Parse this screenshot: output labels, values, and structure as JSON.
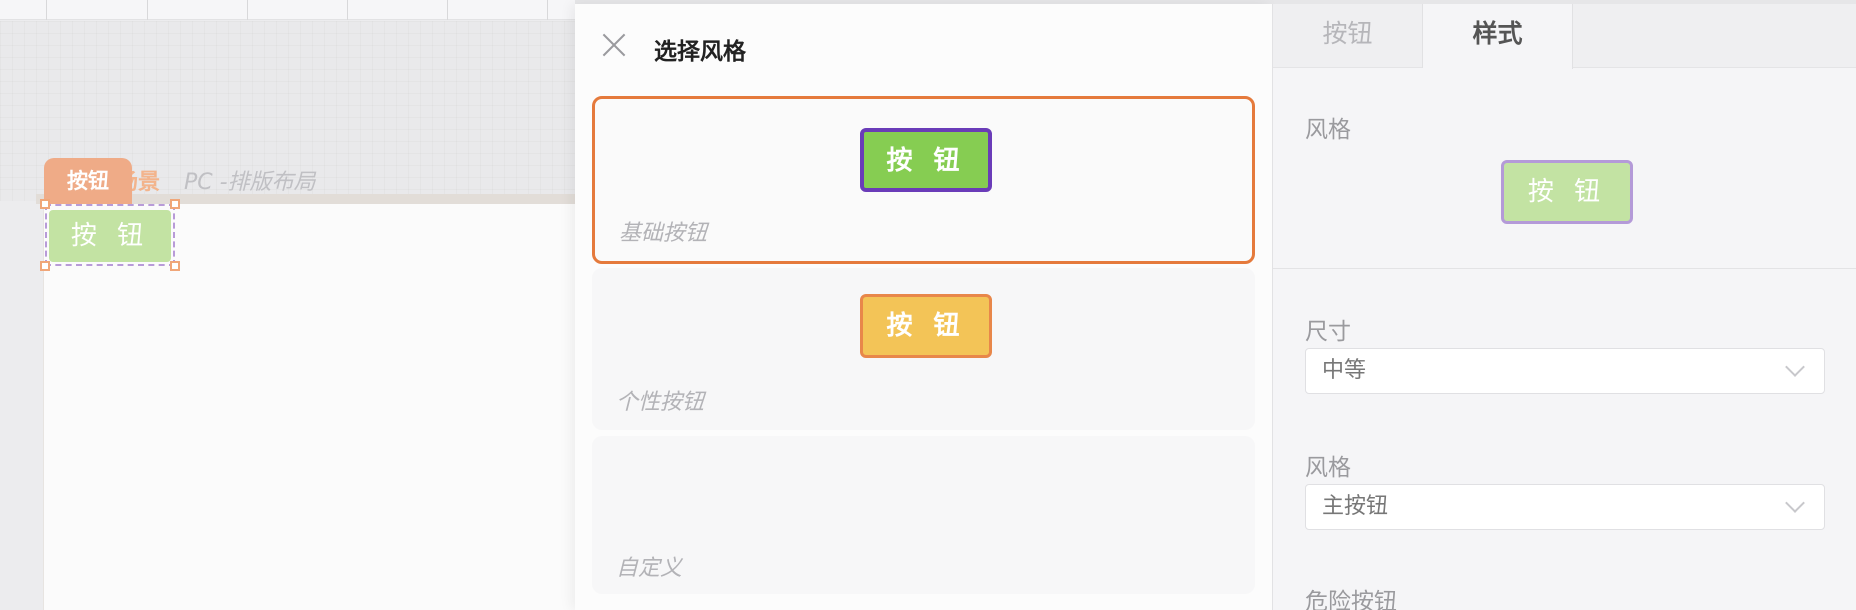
{
  "canvas": {
    "tag_label": "按钮",
    "page_title": "场景",
    "page_subtitle": "PC -排版布局",
    "selected_button_label": "按 钮"
  },
  "modal": {
    "title": "选择风格",
    "cards": [
      {
        "label": "基础按钮",
        "button_label": "按 钮",
        "selected": true,
        "button_color": "#86cd52",
        "button_border": "#6a3cb8"
      },
      {
        "label": "个性按钮",
        "button_label": "按 钮",
        "selected": false,
        "button_color": "#f3c457",
        "button_border": "#e8874a"
      },
      {
        "label": "自定义",
        "selected": false
      }
    ]
  },
  "panel": {
    "tabs": [
      {
        "label": "按钮",
        "active": false
      },
      {
        "label": "样式",
        "active": true
      }
    ],
    "style_label": "风格",
    "preview_button_label": "按 钮",
    "size_label": "尺寸",
    "size_value": "中等",
    "style2_label": "风格",
    "style2_value": "主按钮",
    "danger_label": "危险按钮"
  },
  "colors": {
    "accent_orange": "#e57a3c",
    "tag_orange": "#efab87",
    "primary_green": "#86cd52",
    "light_green": "#c3e3a3",
    "purple": "#b49ad8"
  }
}
